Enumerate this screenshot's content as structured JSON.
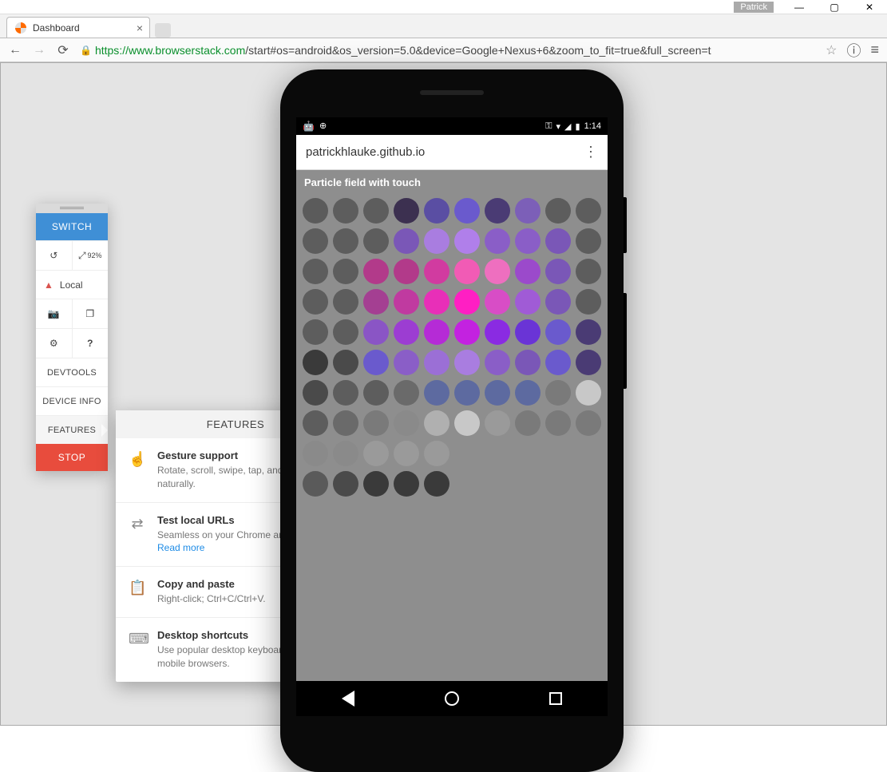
{
  "window": {
    "user_label": "Patrick"
  },
  "browser": {
    "tab_title": "Dashboard",
    "url_protocol": "https",
    "url_host": "://www.browserstack.com",
    "url_path": "/start#os=android&os_version=5.0&device=Google+Nexus+6&zoom_to_fit=true&full_screen=t"
  },
  "sidebar": {
    "switch_label": "SWITCH",
    "zoom_value": "92%",
    "local_label": "Local",
    "devtools_label": "DEVTOOLS",
    "deviceinfo_label": "DEVICE INFO",
    "features_label": "FEATURES",
    "stop_label": "STOP"
  },
  "features_popup": {
    "title": "FEATURES",
    "items": [
      {
        "title": "Gesture support",
        "desc": "Rotate, scroll, swipe, tap, and tap and hold naturally."
      },
      {
        "title": "Test local URLs",
        "desc": "Seamless on your Chrome and Firefox. ",
        "link": "Read more"
      },
      {
        "title": "Copy and paste",
        "desc": "Right-click; Ctrl+C/Ctrl+V."
      },
      {
        "title": "Desktop shortcuts",
        "desc": "Use popular desktop keyboard shortcuts on mobile browsers."
      }
    ]
  },
  "phone": {
    "status_time": "1:14",
    "url_text": "patrickhlauke.github.io",
    "page_heading": "Particle field with touch",
    "dot_colors": [
      [
        "#5b5b5b",
        "#5d5d5d",
        "#5d5d5d",
        "#3c3050",
        "#5a4ea3",
        "#6a5acd",
        "#4a3b74",
        "#7c5fb8",
        "#5d5d5d",
        "#5d5d5d"
      ],
      [
        "#5d5d5d",
        "#5d5d5d",
        "#5d5d5d",
        "#7a57b7",
        "#a97de0",
        "#b07fea",
        "#8a5ec7",
        "#8a5ec7",
        "#7a57b7",
        "#5d5d5d"
      ],
      [
        "#5d5d5d",
        "#5d5d5d",
        "#b23a8a",
        "#b23a8a",
        "#d13ba0",
        "#f15bb5",
        "#ee6fbf",
        "#9b4acb",
        "#7a57b7",
        "#5d5d5d"
      ],
      [
        "#5d5d5d",
        "#5d5d5d",
        "#a43f92",
        "#c03aa0",
        "#e82fb8",
        "#ff1fc3",
        "#d84dc6",
        "#a05bd6",
        "#7a57b7",
        "#5d5d5d"
      ],
      [
        "#5d5d5d",
        "#5d5d5d",
        "#8a55c5",
        "#9c3dd2",
        "#b52bd6",
        "#c322e0",
        "#8a2be2",
        "#6a34d6",
        "#6a5acd",
        "#4a3b74"
      ],
      [
        "#3a3a3a",
        "#4a4a4a",
        "#6a5acd",
        "#8a5ec7",
        "#9b6fd6",
        "#a97de0",
        "#8a5ec7",
        "#7a57b7",
        "#6a5acd",
        "#4a3b74"
      ],
      [
        "#4a4a4a",
        "#5d5d5d",
        "#5d5d5d",
        "#6a6a6a",
        "#5d6aa0",
        "#5d6aa0",
        "#5d6aa0",
        "#5d6aa0",
        "#7a7a7a",
        "#c8c8c8"
      ],
      [
        "#5d5d5d",
        "#6a6a6a",
        "#7a7a7a",
        "#8a8a8a",
        "#b0b0b0",
        "#c8c8c8",
        "#9a9a9a",
        "#7a7a7a",
        "#7a7a7a",
        "#7a7a7a"
      ],
      [
        "#8a8a8a",
        "#8a8a8a",
        "#9a9a9a",
        "#9a9a9a",
        "#9a9a9a",
        "",
        "",
        "",
        "",
        ""
      ],
      [
        "#5a5a5a",
        "#4a4a4a",
        "#3a3a3a",
        "#3a3a3a",
        "#3a3a3a",
        "",
        "",
        "",
        "",
        ""
      ]
    ]
  }
}
